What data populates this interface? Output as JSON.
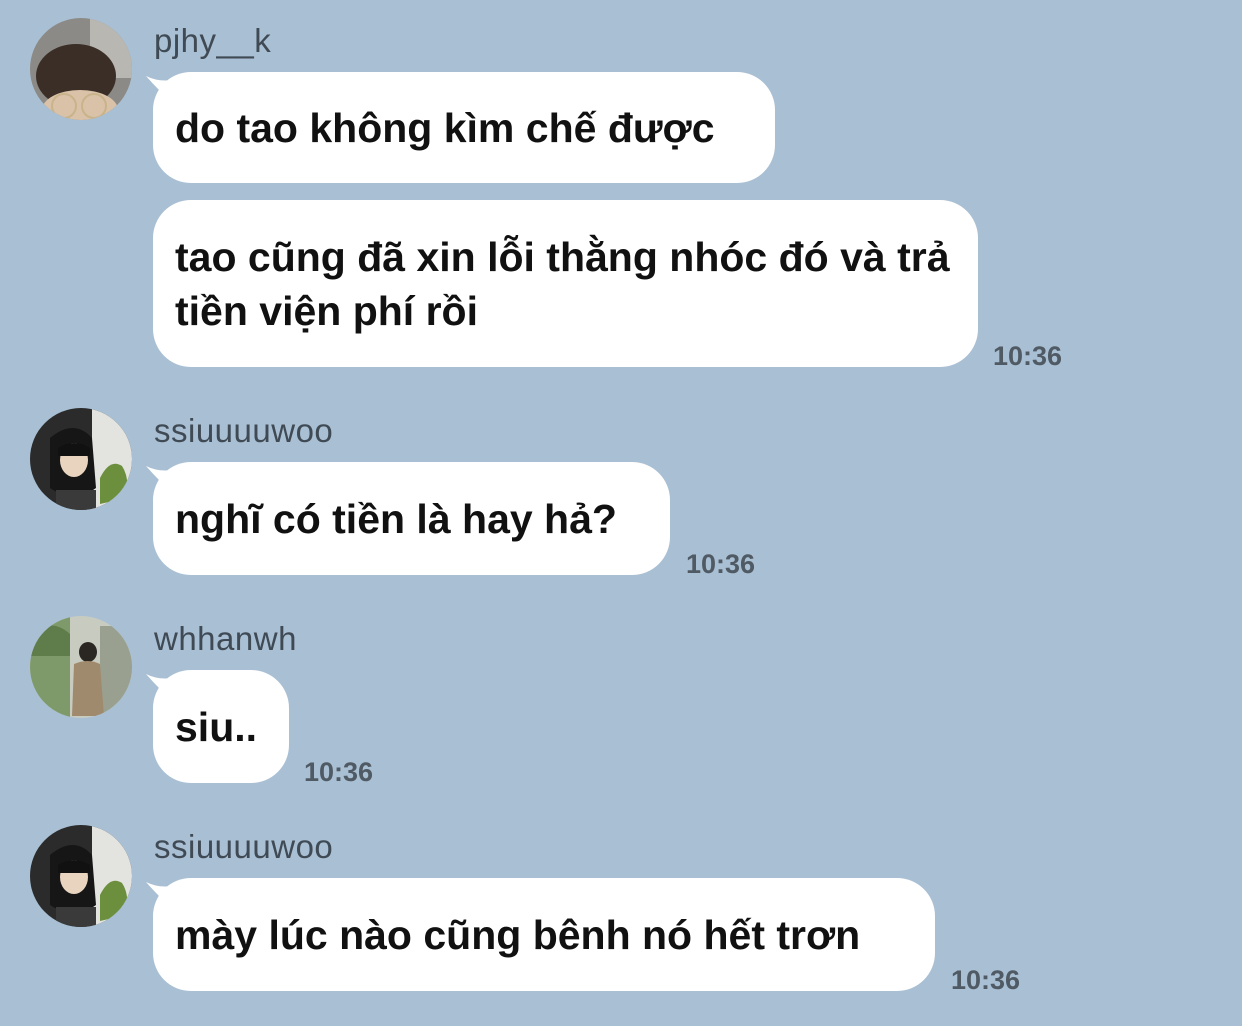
{
  "chat": {
    "messages": [
      {
        "sender": "pjhy__k",
        "bubbles": [
          "do tao không kìm chế được",
          "tao cũng đã xin lỗi thằng nhóc đó và trả tiền viện phí rồi"
        ],
        "time": "10:36"
      },
      {
        "sender": "ssiuuuuwoo",
        "bubbles": [
          "nghĩ có tiền là hay hả?"
        ],
        "time": "10:36"
      },
      {
        "sender": "whhanwh",
        "bubbles": [
          "siu.."
        ],
        "time": "10:36"
      },
      {
        "sender": "ssiuuuuwoo",
        "bubbles": [
          "mày lúc nào cũng bênh nó hết trơn"
        ],
        "time": "10:36"
      }
    ]
  },
  "colors": {
    "background": "#a9bfd3",
    "bubble": "#ffffff",
    "sender_text": "#3f4a55",
    "time_text": "#4f5a64"
  }
}
